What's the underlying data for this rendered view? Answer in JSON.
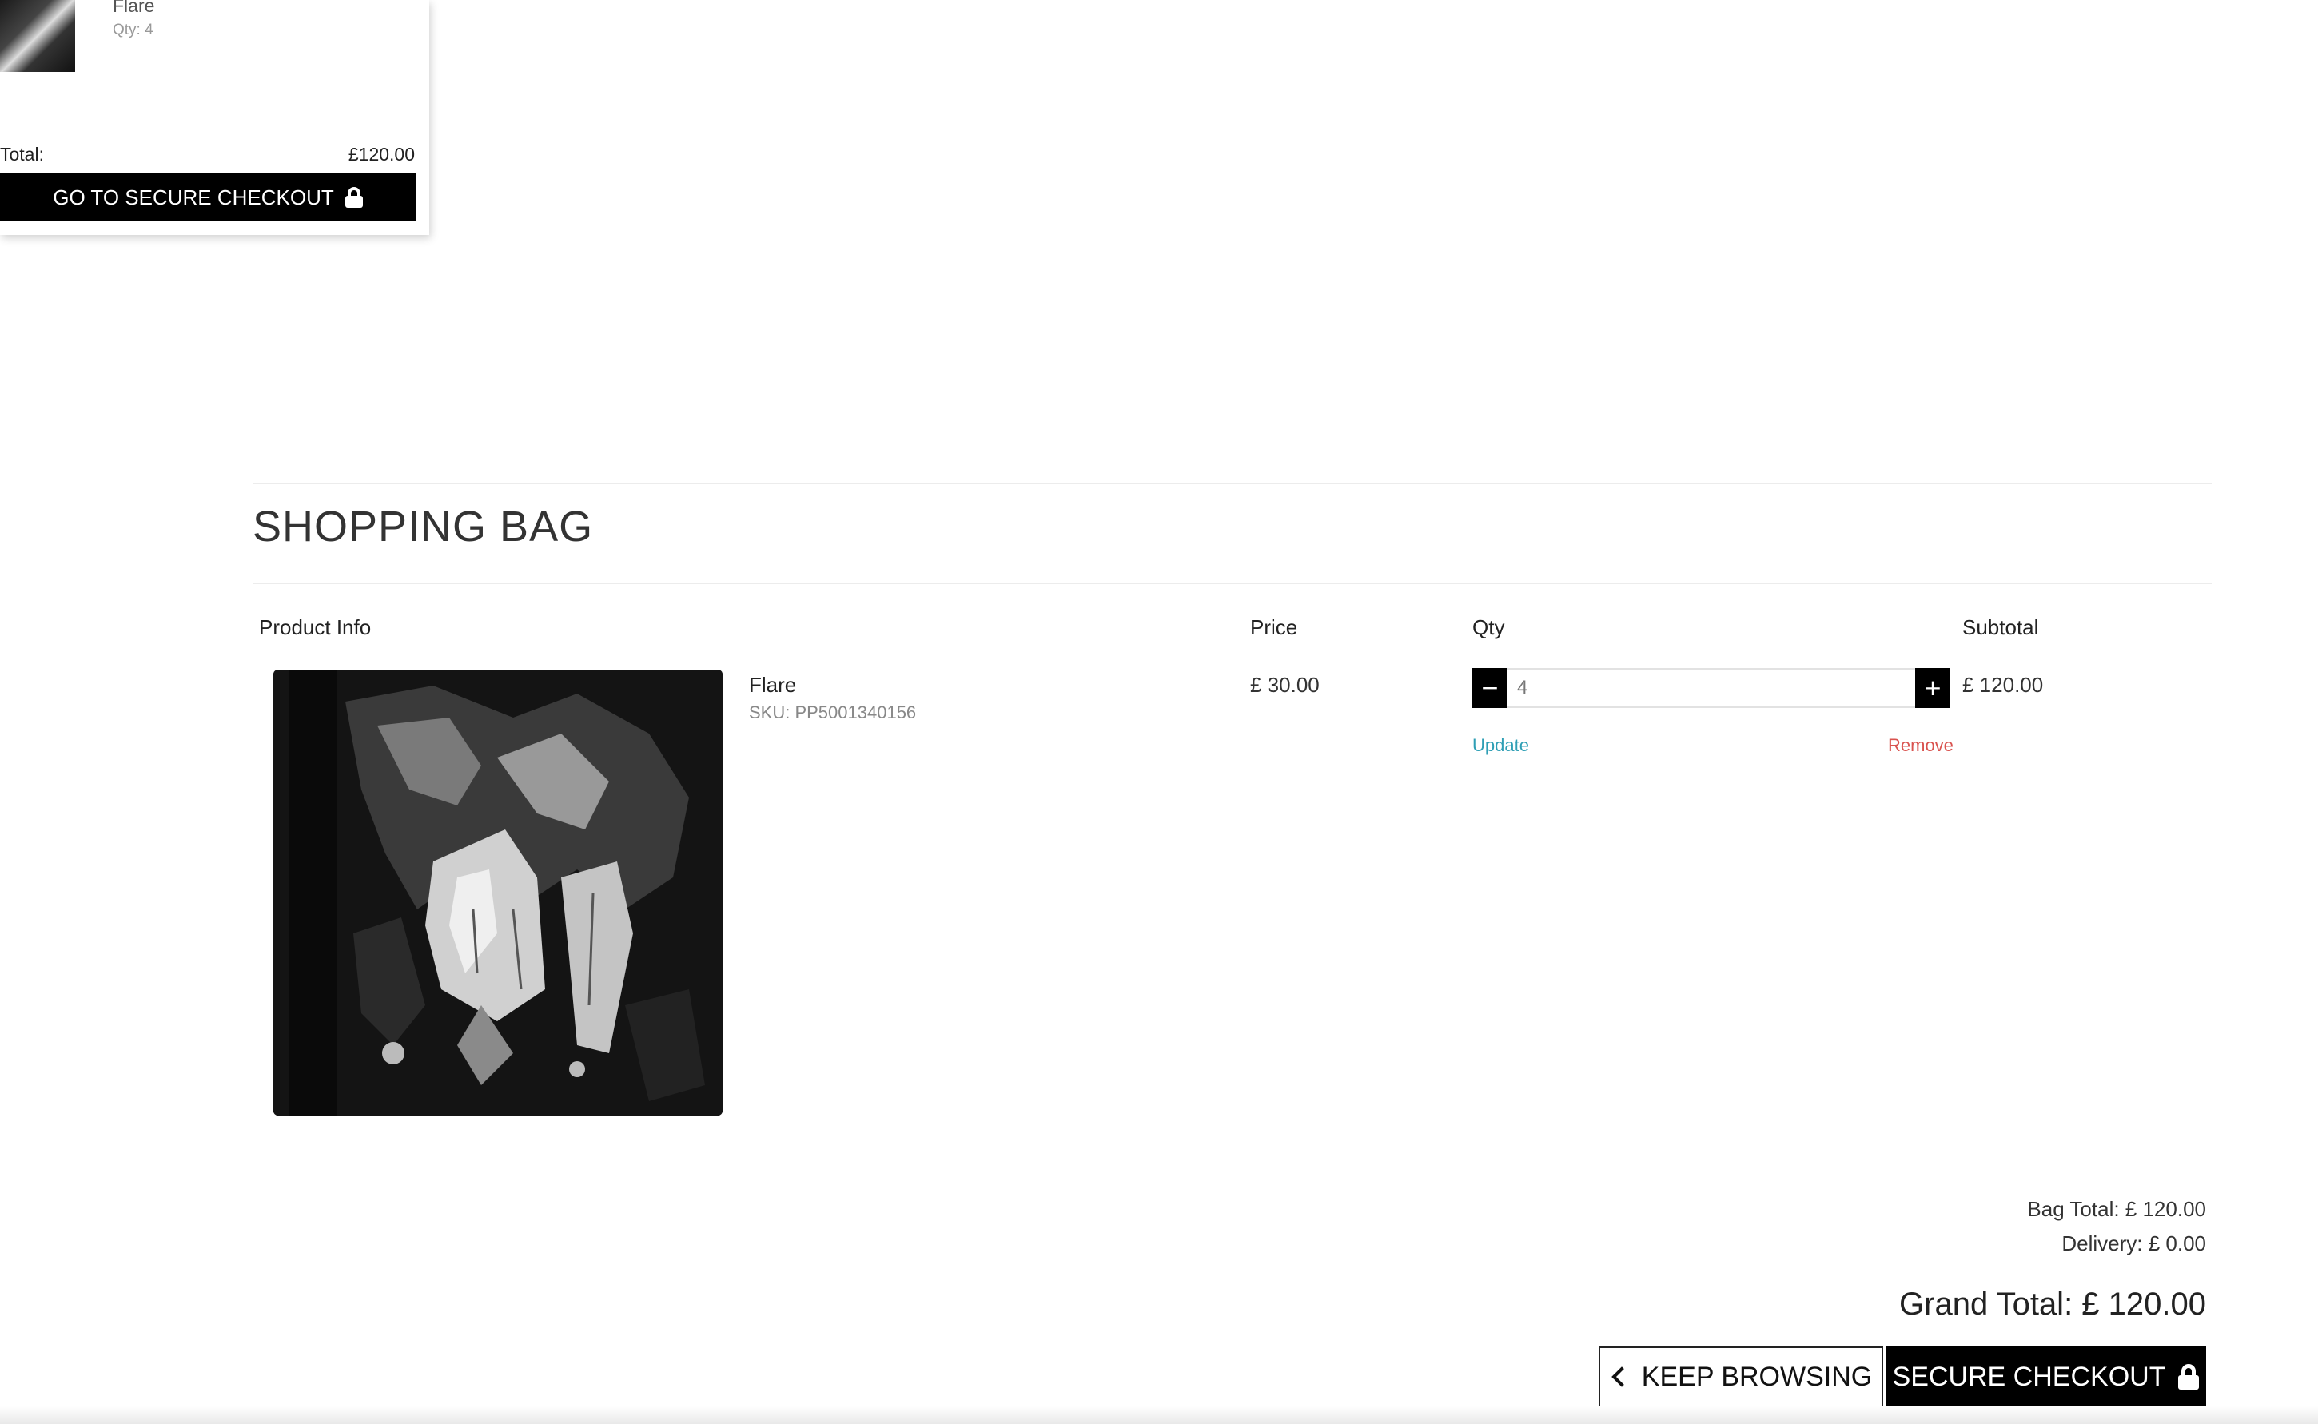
{
  "mini_bag": {
    "item_name": "Flare",
    "item_qty": "Qty: 4",
    "total_label": "Total:",
    "total_value": "£120.00",
    "checkout_label": "GO TO SECURE CHECKOUT",
    "checkout_icon": "lock-icon"
  },
  "bag": {
    "title": "SHOPPING BAG",
    "columns": {
      "product": "Product Info",
      "price": "Price",
      "qty": "Qty",
      "subtotal": "Subtotal"
    },
    "items": [
      {
        "name": "Flare",
        "sku": "SKU: PP5001340156",
        "price": "£ 30.00",
        "qty": "4",
        "subtotal": "£ 120.00",
        "decrement_icon": "minus-icon",
        "increment_icon": "plus-icon",
        "update_label": "Update",
        "remove_label": "Remove"
      }
    ]
  },
  "totals": {
    "bag_total": "Bag Total: £ 120.00",
    "delivery": "Delivery: £ 0.00",
    "grand_total": "Grand Total: £ 120.00"
  },
  "actions": {
    "keep_browsing": "KEEP BROWSING",
    "keep_browsing_icon": "chevron-left-icon",
    "secure_checkout": "SECURE CHECKOUT",
    "secure_checkout_icon": "lock-icon"
  },
  "colors": {
    "update_link": "#2f9fb5",
    "remove_link": "#d9534f",
    "button_dark": "#000000"
  }
}
